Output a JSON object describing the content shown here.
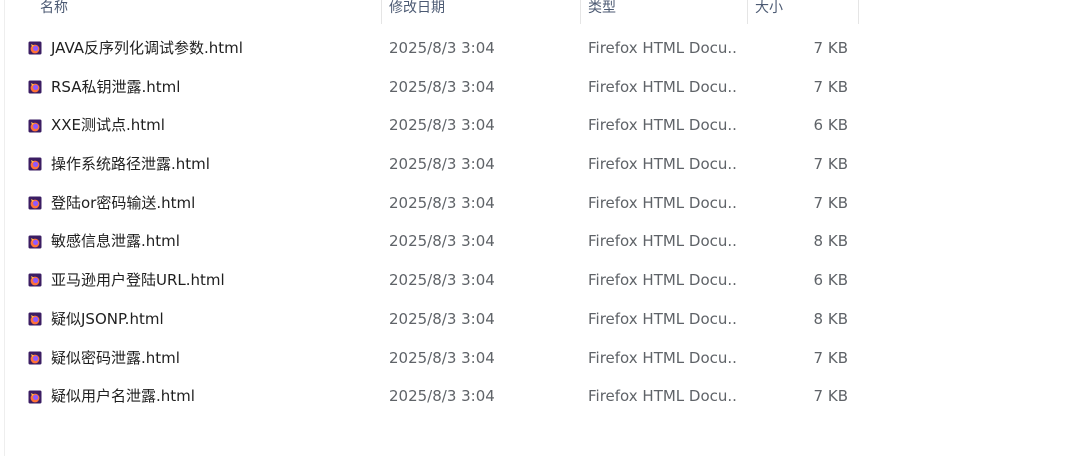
{
  "columns": {
    "name": "名称",
    "date": "修改日期",
    "type": "类型",
    "size": "大小"
  },
  "files": [
    {
      "name": "JAVA反序列化调试参数.html",
      "date": "2025/8/3 3:04",
      "type": "Firefox HTML Docu...",
      "size": "7 KB",
      "icon": "firefox-html-file-icon"
    },
    {
      "name": "RSA私钥泄露.html",
      "date": "2025/8/3 3:04",
      "type": "Firefox HTML Docu...",
      "size": "7 KB",
      "icon": "firefox-html-file-icon"
    },
    {
      "name": "XXE测试点.html",
      "date": "2025/8/3 3:04",
      "type": "Firefox HTML Docu...",
      "size": "6 KB",
      "icon": "firefox-html-file-icon"
    },
    {
      "name": "操作系统路径泄露.html",
      "date": "2025/8/3 3:04",
      "type": "Firefox HTML Docu...",
      "size": "7 KB",
      "icon": "firefox-html-file-icon"
    },
    {
      "name": "登陆or密码输送.html",
      "date": "2025/8/3 3:04",
      "type": "Firefox HTML Docu...",
      "size": "7 KB",
      "icon": "firefox-html-file-icon"
    },
    {
      "name": "敏感信息泄露.html",
      "date": "2025/8/3 3:04",
      "type": "Firefox HTML Docu...",
      "size": "8 KB",
      "icon": "firefox-html-file-icon"
    },
    {
      "name": "亚马逊用户登陆URL.html",
      "date": "2025/8/3 3:04",
      "type": "Firefox HTML Docu...",
      "size": "6 KB",
      "icon": "firefox-html-file-icon"
    },
    {
      "name": "疑似JSONP.html",
      "date": "2025/8/3 3:04",
      "type": "Firefox HTML Docu...",
      "size": "8 KB",
      "icon": "firefox-html-file-icon"
    },
    {
      "name": "疑似密码泄露.html",
      "date": "2025/8/3 3:04",
      "type": "Firefox HTML Docu...",
      "size": "7 KB",
      "icon": "firefox-html-file-icon"
    },
    {
      "name": "疑似用户名泄露.html",
      "date": "2025/8/3 3:04",
      "type": "Firefox HTML Docu...",
      "size": "7 KB",
      "icon": "firefox-html-file-icon"
    }
  ],
  "colors": {
    "header_text": "#4c5a73",
    "name_text": "#1f1f1f",
    "meta_text": "#5f6368",
    "icon_orange": "#ff7139",
    "icon_purple": "#9059ff"
  }
}
